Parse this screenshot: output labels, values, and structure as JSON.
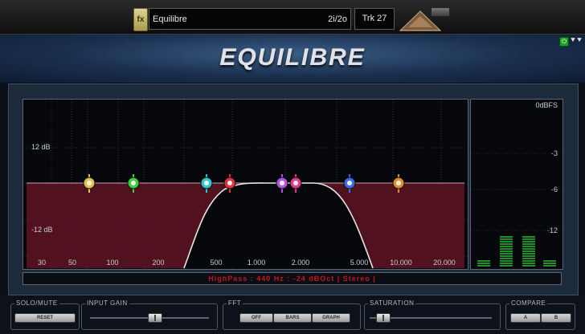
{
  "topbar": {
    "fx_label": "fx",
    "preset_name": "Equilibre",
    "io_config": "2i/2o",
    "track": "Trk 27"
  },
  "plugin": {
    "title": "EQUILIBRE"
  },
  "graph": {
    "db_labels": [
      "12 dB",
      "-12 dB"
    ],
    "freq_labels": [
      "30",
      "50",
      "100",
      "200",
      "500",
      "1.000",
      "2.000",
      "5.000",
      "10.000",
      "20.000"
    ],
    "band_colors": [
      "#e5c04a",
      "#3ad13a",
      "#2fc7d0",
      "#e0313e",
      "#b355e0",
      "#e33a8c",
      "#3d6ae5",
      "#e38a33"
    ],
    "curve_color": "#e8e8e8",
    "fill_color": "#6b1626"
  },
  "meter": {
    "labels": [
      "0dBFS",
      "-3",
      "-6",
      "-12"
    ],
    "bar_levels": [
      0.15,
      0.62,
      0.64,
      0.15
    ],
    "bar_color": "#1f8f2a"
  },
  "status": {
    "text": "HighPass : 440 Hz : -24 dBOct | Stereo |"
  },
  "controls": {
    "solo_mute": {
      "label": "SOLO/MUTE",
      "reset_label": "RESET"
    },
    "input_gain": {
      "label": "INPUT GAIN",
      "level": 0.55
    },
    "fft": {
      "label": "FFT",
      "modes": [
        "OFF",
        "BARS",
        "GRAPH"
      ]
    },
    "saturation": {
      "label": "SATURATION",
      "level": 0.05
    },
    "compare": {
      "label": "COMPARE",
      "a_label": "A",
      "b_label": "B"
    }
  }
}
